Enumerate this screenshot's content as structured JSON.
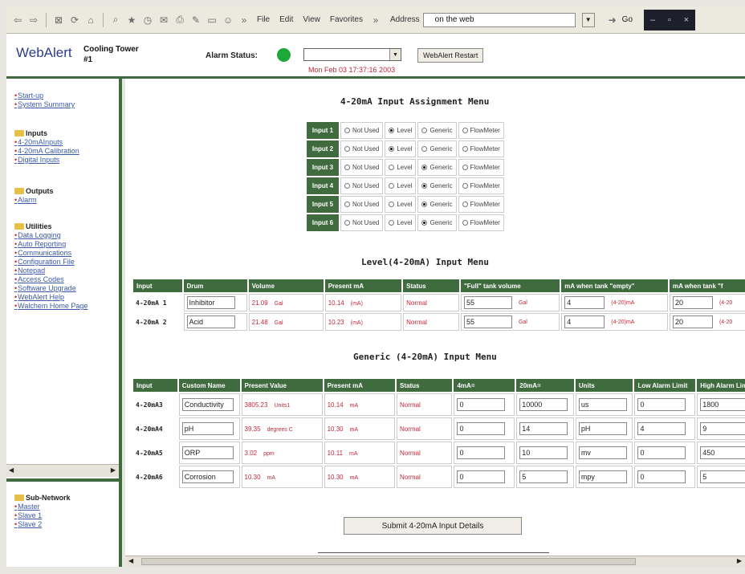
{
  "browser": {
    "menus": [
      "File",
      "Edit",
      "View",
      "Favorites"
    ],
    "address_label": "Address",
    "address_value": "on the web",
    "go_label": "Go"
  },
  "header": {
    "logo": "WebAlert",
    "unit_name": "Cooling Tower #1",
    "alarm_label": "Alarm Status:",
    "restart_label": "WebAlert Restart",
    "timestamp": "Mon Feb 03 17:37:16 2003"
  },
  "sidebar": {
    "top_links": [
      "Start-up",
      "System Summary"
    ],
    "inputs_head": "Inputs",
    "inputs_links": [
      "4-20mAInputs",
      "4-20mA Calibration",
      "Digital Inputs"
    ],
    "outputs_head": "Outputs",
    "outputs_links": [
      "Alarm"
    ],
    "utilities_head": "Utilities",
    "utilities_links": [
      "Data Logging",
      "Auto Reporting",
      "Communications",
      "Configuration File",
      "Notepad",
      "Access Codes",
      "Software Upgrade",
      "WebAlert Help",
      "Walchem Home Page"
    ],
    "subnet_head": "Sub-Network",
    "subnet_links": [
      "Master",
      "Slave 1",
      "Slave 2"
    ]
  },
  "assignment": {
    "title": "4-20mA Input Assignment Menu",
    "options": [
      "Not Used",
      "Level",
      "Generic",
      "FlowMeter"
    ],
    "rows": [
      {
        "label": "Input 1",
        "selected": 1
      },
      {
        "label": "Input 2",
        "selected": 1
      },
      {
        "label": "Input 3",
        "selected": 2
      },
      {
        "label": "Input 4",
        "selected": 2
      },
      {
        "label": "Input 5",
        "selected": 2
      },
      {
        "label": "Input 6",
        "selected": 2
      }
    ]
  },
  "level": {
    "title": "Level(4-20mA) Input Menu",
    "headers": [
      "Input",
      "Drum",
      "Volume",
      "Present mA",
      "Status",
      "\"Full\" tank volume",
      "mA when tank \"empty\"",
      "mA when tank \"f"
    ],
    "rows": [
      {
        "input": "4-20mA 1",
        "drum": "Inhibitor",
        "volume": "21.09",
        "vol_unit": "Gal",
        "ma": "10.14",
        "ma_unit": "(mA)",
        "status": "Normal",
        "full": "55",
        "full_unit": "Gal",
        "empty": "4",
        "empty_unit": "(4-20)mA",
        "fullma": "20",
        "fullma_unit": "(4-20"
      },
      {
        "input": "4-20mA 2",
        "drum": "Acid",
        "volume": "21.48",
        "vol_unit": "Gal",
        "ma": "10.23",
        "ma_unit": "(mA)",
        "status": "Normal",
        "full": "55",
        "full_unit": "Gal",
        "empty": "4",
        "empty_unit": "(4-20)mA",
        "fullma": "20",
        "fullma_unit": "(4-20"
      }
    ]
  },
  "generic": {
    "title": "Generic (4-20mA) Input Menu",
    "headers": [
      "Input",
      "Custom Name",
      "Present Value",
      "Present mA",
      "Status",
      "4mA=",
      "20mA=",
      "Units",
      "Low Alarm Limit",
      "High Alarm Limit"
    ],
    "rows": [
      {
        "input": "4-20mA3",
        "name": "Conductivity",
        "value": "3805.23",
        "v_unit": "Units1",
        "ma": "10.14",
        "ma_unit": "mA",
        "status": "Normal",
        "low": "0",
        "high": "10000",
        "units": "us",
        "lo_alarm": "0",
        "hi_alarm": "1800"
      },
      {
        "input": "4-20mA4",
        "name": "pH",
        "value": "39.35",
        "v_unit": "degrees C",
        "ma": "10.30",
        "ma_unit": "mA",
        "status": "Normal",
        "low": "0",
        "high": "14",
        "units": "pH",
        "lo_alarm": "4",
        "hi_alarm": "9"
      },
      {
        "input": "4-20mA5",
        "name": "ORP",
        "value": "3.02",
        "v_unit": "ppm",
        "ma": "10.11",
        "ma_unit": "mA",
        "status": "Normal",
        "low": "0",
        "high": "10",
        "units": "mv",
        "lo_alarm": "0",
        "hi_alarm": "450"
      },
      {
        "input": "4-20mA6",
        "name": "Corrosion",
        "value": "10.30",
        "v_unit": "mA",
        "ma": "10.30",
        "ma_unit": "mA",
        "status": "Normal",
        "low": "0",
        "high": "5",
        "units": "mpy",
        "lo_alarm": "0",
        "hi_alarm": "5"
      }
    ]
  },
  "submit_label": "Submit 4-20mA Input Details",
  "colors": {
    "accent_green": "#3f6b3f",
    "alarm_ok": "#1fa83a",
    "value_red": "#c0283a",
    "link_blue": "#3a5aa8"
  }
}
